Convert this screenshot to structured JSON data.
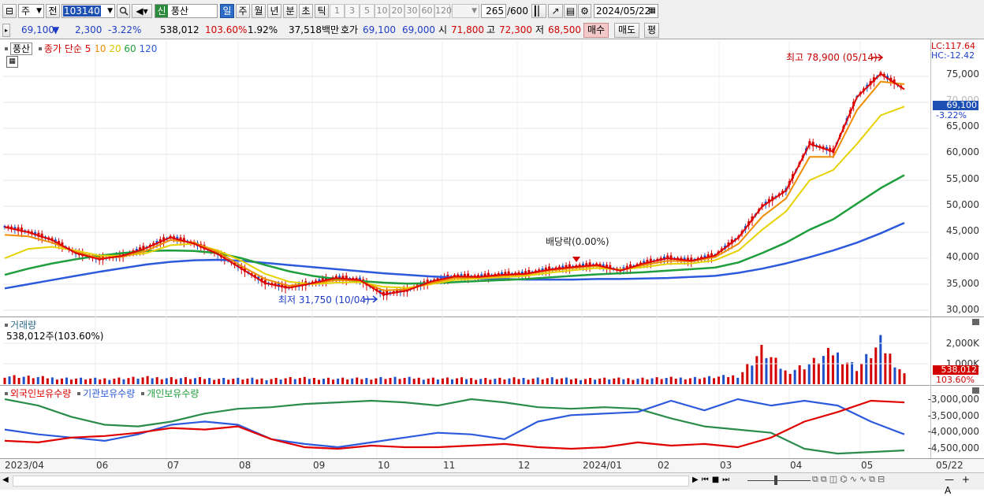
{
  "toolbar": {
    "market_type": "주",
    "prev_button": "전",
    "code": "103140",
    "new_badge": "신",
    "stock_name": "풍산",
    "periods": [
      "일",
      "주",
      "월",
      "년",
      "분",
      "초",
      "틱"
    ],
    "period_numbers": [
      "1",
      "3",
      "5",
      "10",
      "20",
      "30",
      "60",
      "120"
    ],
    "count_value": "265",
    "count_max": "/600",
    "date_value": "2024/05/22"
  },
  "quote": {
    "price": "69,100",
    "change_arrow": "▼",
    "change": "2,300",
    "change_pct": "-3.22%",
    "volume": "538,012",
    "volume_ratio": "103.60%",
    "turnover": "1.92%",
    "amount": "37,518백만",
    "hoga_label": "호가",
    "ask": "69,100",
    "bid": "69,000",
    "open_label": "시",
    "open": "71,800",
    "high_label": "고",
    "high": "72,300",
    "low_label": "저",
    "low": "68,500",
    "buy_button": "매수",
    "sell_button": "매도",
    "eval_button": "평"
  },
  "price_panel": {
    "legend_name": "풍산",
    "legend_ma_title": "종가 단순",
    "ma_periods": [
      "5",
      "10",
      "20",
      "60",
      "120"
    ],
    "ma_colors": [
      "#e00000",
      "#f08c00",
      "#e6d200",
      "#1e9e3c",
      "#2d5adc"
    ],
    "lc": "LC:117.64",
    "hc": "HC:-12.42",
    "y_ticks": [
      "75,000",
      "70,000",
      "65,000",
      "60,000",
      "55,000",
      "50,000",
      "45,000",
      "40,000",
      "35,000",
      "30,000"
    ],
    "current_price_tag": "69,100",
    "current_pct_tag": "-3.22%",
    "high_annotation": "최고 78,900 (05/14)",
    "low_annotation": "최저 31,750 (10/04)",
    "dividend_annotation": "배당락(0.00%)"
  },
  "volume_panel": {
    "title": "거래량",
    "value": "538,012주(103.60%)",
    "y_ticks": [
      "2,000K",
      "1,000K"
    ],
    "tag_value": "538,012",
    "tag_pct": "103.60%"
  },
  "holdings_panel": {
    "series": [
      {
        "name": "외국인보유수량",
        "color": "#e00000"
      },
      {
        "name": "기관보유수량",
        "color": "#2d5adc"
      },
      {
        "name": "개인보유수량",
        "color": "#1e9e3c"
      }
    ],
    "y_ticks": [
      "-3,000,000",
      "-3,500,000",
      "-4,000,000",
      "-4,500,000"
    ]
  },
  "x_axis": {
    "labels": [
      "2023/04",
      "06",
      "07",
      "08",
      "09",
      "10",
      "11",
      "12",
      "2024/01",
      "02",
      "03",
      "04",
      "05"
    ],
    "end_date": "05/22"
  },
  "chart_data": {
    "type": "line",
    "title": "풍산",
    "x_start": "2023/04",
    "x_end": "2024/05/22",
    "ylim": [
      30000,
      78000
    ],
    "high": {
      "value": 78900,
      "date": "05/14"
    },
    "low": {
      "value": 31750,
      "date": "10/04"
    },
    "last_close": 69100,
    "series": [
      {
        "name": "5",
        "values": [
          46000,
          45000,
          43500,
          41000,
          39800,
          40500,
          42000,
          44000,
          42800,
          40800,
          38000,
          35200,
          34300,
          35200,
          36200,
          35800,
          33000,
          33800,
          35500,
          36500,
          36400,
          36800,
          37000,
          37800,
          38300,
          38700,
          37600,
          39000,
          40000,
          39500,
          40500,
          44000,
          50000,
          53000,
          62000,
          60500,
          71000,
          75500,
          72500
        ]
      },
      {
        "name": "10",
        "values": [
          44500,
          44200,
          43000,
          41200,
          40000,
          40300,
          41500,
          43500,
          43000,
          41200,
          38500,
          36000,
          34700,
          35100,
          35800,
          35700,
          33800,
          34000,
          35200,
          36200,
          36300,
          36600,
          36900,
          37600,
          38100,
          38500,
          37700,
          38700,
          39500,
          39400,
          40200,
          42800,
          48000,
          51500,
          59500,
          59500,
          68500,
          74000,
          73500
        ]
      },
      {
        "name": "20",
        "values": [
          40000,
          41800,
          42200,
          41500,
          40500,
          40500,
          41000,
          42500,
          42800,
          41500,
          39500,
          37000,
          35500,
          35000,
          35300,
          35400,
          34500,
          34300,
          35000,
          35800,
          36100,
          36300,
          36600,
          37200,
          37700,
          38100,
          37800,
          38300,
          38900,
          39000,
          39600,
          41500,
          45500,
          49000,
          55000,
          57000,
          62000,
          67500,
          69200
        ]
      },
      {
        "name": "60",
        "values": [
          36800,
          38000,
          39000,
          39800,
          40500,
          41000,
          41400,
          41500,
          41400,
          41000,
          40000,
          38700,
          37500,
          36600,
          36000,
          35600,
          35300,
          35100,
          35200,
          35400,
          35600,
          35800,
          36000,
          36300,
          36600,
          36900,
          37100,
          37300,
          37600,
          37900,
          38200,
          39200,
          41000,
          43000,
          45500,
          47500,
          50500,
          53500,
          56000
        ]
      },
      {
        "name": "120",
        "values": [
          34200,
          35000,
          35800,
          36600,
          37400,
          38100,
          38800,
          39300,
          39600,
          39700,
          39500,
          39100,
          38700,
          38300,
          37900,
          37500,
          37100,
          36800,
          36500,
          36300,
          36100,
          36000,
          35900,
          35900,
          35900,
          36000,
          36000,
          36100,
          36200,
          36400,
          36600,
          37200,
          38000,
          39000,
          40200,
          41500,
          43000,
          44800,
          46800
        ]
      }
    ],
    "volume_values": [
      420,
      360,
      310,
      280,
      260,
      300,
      330,
      310,
      290,
      280,
      270,
      260,
      300,
      290,
      280,
      270,
      320,
      300,
      290,
      280,
      280,
      270,
      290,
      300,
      260,
      280,
      270,
      290,
      300,
      310,
      350,
      420,
      1700,
      600,
      1000,
      1600,
      800,
      2000,
      480
    ]
  }
}
